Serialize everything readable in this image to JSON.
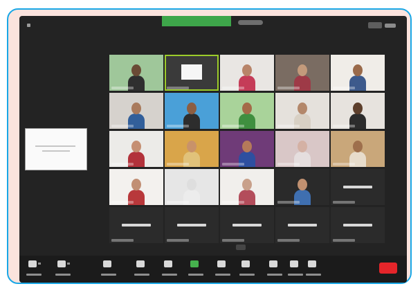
{
  "window": {
    "app": "zoom-meeting",
    "recording_color": "#3ea64a",
    "active_speaker_color": "#9ccc2a",
    "end_button_color": "#e5252a"
  },
  "participants": [
    {
      "kind": "video",
      "bg": "#9fc79a",
      "skin": "#6a4a35",
      "shirt": "#2f2f2f"
    },
    {
      "kind": "logo",
      "bg": "#3a3a3a"
    },
    {
      "kind": "video",
      "bg": "#e9e6e3",
      "skin": "#b88469",
      "shirt": "#c53c58"
    },
    {
      "kind": "video",
      "bg": "#7a6c62",
      "skin": "#c39a7b",
      "shirt": "#9e3a47"
    },
    {
      "kind": "video",
      "bg": "#f0ede8",
      "skin": "#9a6a4a",
      "shirt": "#3d5a8c"
    },
    {
      "kind": "video",
      "bg": "#d6d2cd",
      "skin": "#a97a5c",
      "shirt": "#325f9a"
    },
    {
      "kind": "video",
      "bg": "#4aa0d8",
      "skin": "#8c5e42",
      "shirt": "#2d2d2d"
    },
    {
      "kind": "video",
      "bg": "#a9d39a",
      "skin": "#a46a48",
      "shirt": "#3f8f3f"
    },
    {
      "kind": "video",
      "bg": "#e5e1dc",
      "skin": "#b3876a",
      "shirt": "#d8d0c4"
    },
    {
      "kind": "video",
      "bg": "#e7e3de",
      "skin": "#5d3f2c",
      "shirt": "#2c2c2c"
    },
    {
      "kind": "video",
      "bg": "#ecebe8",
      "skin": "#c58f72",
      "shirt": "#b2323b"
    },
    {
      "kind": "video",
      "bg": "#d9a54a",
      "skin": "#c8926a",
      "shirt": "#e1c27a"
    },
    {
      "kind": "video",
      "bg": "#6f3b78",
      "skin": "#b57a5a",
      "shirt": "#2e4fa0"
    },
    {
      "kind": "video",
      "bg": "#d9c7c7",
      "skin": "#d4b1a4",
      "shirt": "#e5dede"
    },
    {
      "kind": "video",
      "bg": "#c9a77a",
      "skin": "#9e6f4c",
      "shirt": "#e7dccb"
    },
    {
      "kind": "video",
      "bg": "#f3f1ee",
      "skin": "#c18f74",
      "shirt": "#b8383b"
    },
    {
      "kind": "video",
      "bg": "#e6e6e6",
      "skin": "#dedede",
      "shirt": "#ececec"
    },
    {
      "kind": "video",
      "bg": "#f1efec",
      "skin": "#c8a08a",
      "shirt": "#b34d5b"
    },
    {
      "kind": "video",
      "bg": "#2a2a2a",
      "skin": "#c09070",
      "shirt": "#3f6fb0"
    },
    {
      "kind": "name",
      "bg": "#2b2b2b"
    },
    {
      "kind": "name",
      "bg": "#2b2b2b"
    },
    {
      "kind": "name",
      "bg": "#2b2b2b"
    },
    {
      "kind": "name",
      "bg": "#2b2b2b"
    },
    {
      "kind": "name",
      "bg": "#2b2b2b"
    },
    {
      "kind": "name",
      "bg": "#2b2b2b"
    }
  ],
  "active_index": 1,
  "toolbar": {
    "items": [
      {
        "icon": "microphone-icon"
      },
      {
        "icon": "video-camera-icon"
      },
      {
        "icon": "security-shield-icon"
      },
      {
        "icon": "participants-icon"
      },
      {
        "icon": "chat-icon"
      },
      {
        "icon": "share-screen-icon",
        "green": true
      },
      {
        "icon": "record-icon"
      },
      {
        "icon": "breakout-rooms-icon"
      },
      {
        "icon": "reactions-icon"
      },
      {
        "icon": "apps-icon"
      },
      {
        "icon": "whiteboard-icon"
      }
    ]
  }
}
